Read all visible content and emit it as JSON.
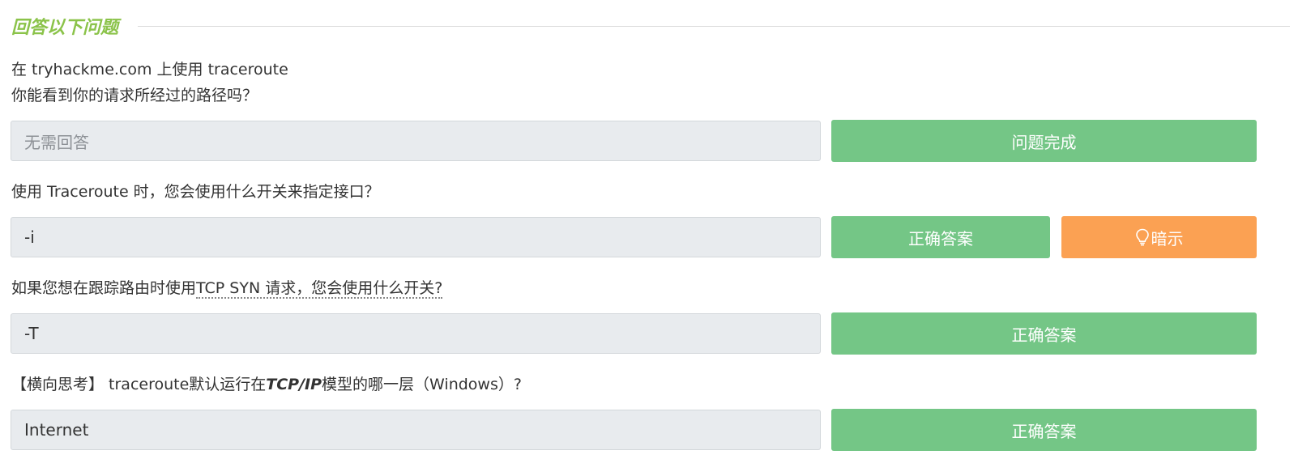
{
  "section": {
    "title": "回答以下问题"
  },
  "questions": [
    {
      "line1": "在 tryhackme.com 上使用 traceroute",
      "line2": "你能看到你的请求所经过的路径吗？",
      "answer_placeholder": "无需回答",
      "button_label": "问题完成"
    },
    {
      "text": "使用 Traceroute 时，您会使用什么开关来指定接口？",
      "answer": "-i",
      "button_label": "正确答案",
      "hint_label": "暗示"
    },
    {
      "text_before": "如果您想在跟踪路由时使用",
      "abbr": "TCP SYN 请求，您会使用什么开关?",
      "answer": "-T",
      "button_label": "正确答案"
    },
    {
      "prefix": "【横向思考】 traceroute默认运行在",
      "emphasis": "TCP/IP",
      "suffix": "模型的哪一层（Windows）?",
      "answer": "Internet",
      "button_label": "正确答案"
    }
  ],
  "colors": {
    "accent": "#8bc34a",
    "success_button": "#74c686",
    "hint_button": "#fba153",
    "input_background": "#e8ebee"
  },
  "icons": {
    "hint": "lightbulb-icon"
  }
}
